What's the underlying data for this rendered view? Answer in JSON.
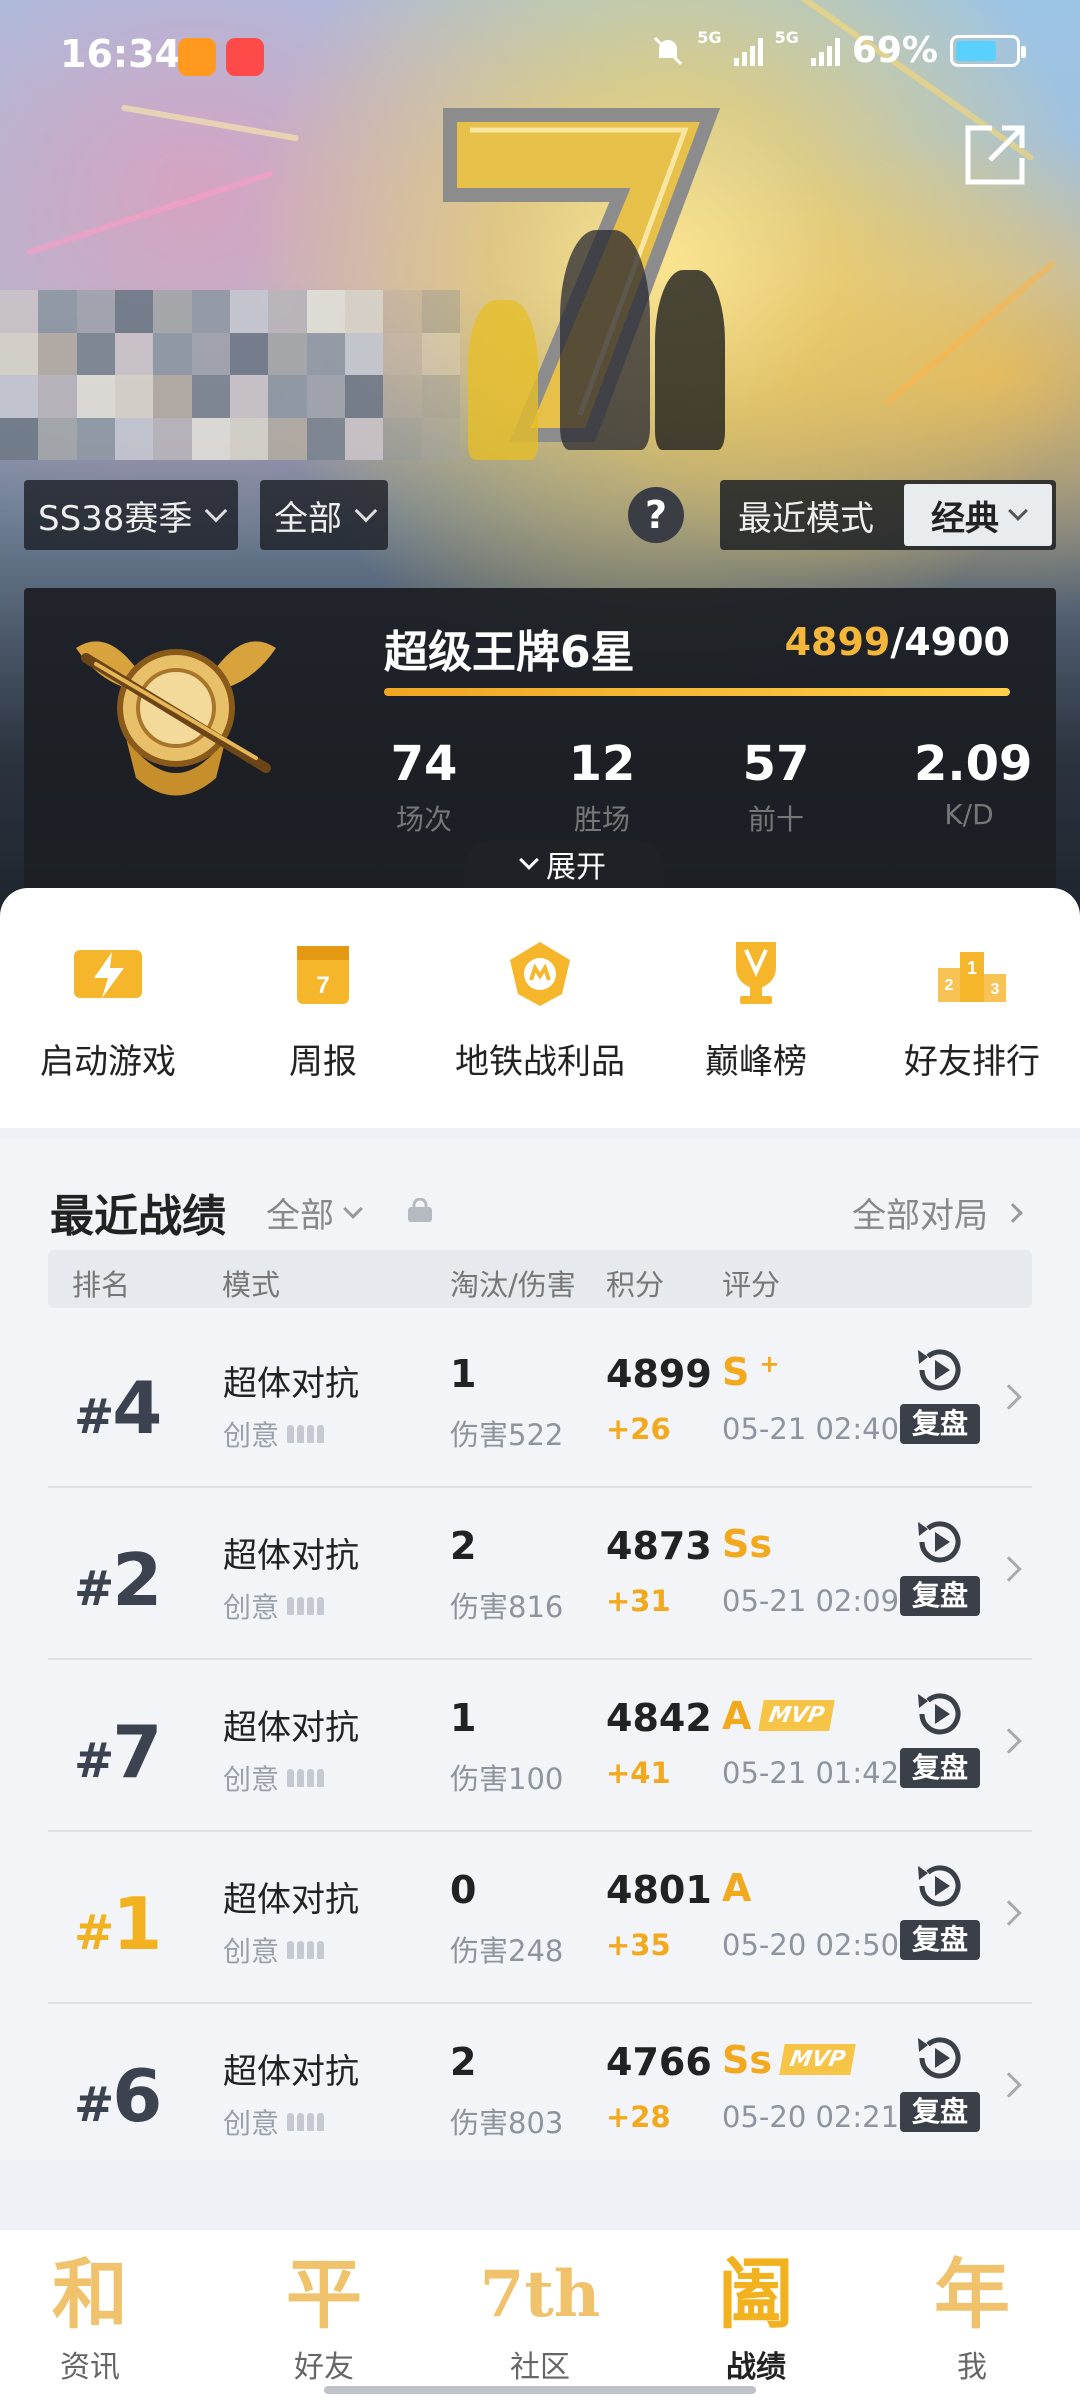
{
  "status_bar": {
    "time": "16:34",
    "network": "5G",
    "battery": "69%",
    "battery_level": 0.69
  },
  "filters": {
    "season": "SS38赛季",
    "scope": "全部",
    "recent_mode_label": "最近模式",
    "mode_selected": "经典"
  },
  "rank": {
    "name": "超级王牌6星",
    "score_current": "4899",
    "score_total": "/4900",
    "progress": 0.9998,
    "stats": [
      {
        "value": "74",
        "label": "场次"
      },
      {
        "value": "12",
        "label": "胜场"
      },
      {
        "value": "57",
        "label": "前十"
      },
      {
        "value": "2.09",
        "label": "K/D"
      }
    ],
    "expand_label": "展开"
  },
  "quick_actions": [
    {
      "label": "启动游戏",
      "icon": "lightning-icon"
    },
    {
      "label": "周报",
      "icon": "calendar-icon"
    },
    {
      "label": "地铁战利品",
      "icon": "metro-badge-icon"
    },
    {
      "label": "巅峰榜",
      "icon": "trophy-icon"
    },
    {
      "label": "好友排行",
      "icon": "podium-icon"
    }
  ],
  "records": {
    "title": "最近战绩",
    "filter": "全部",
    "all_matches": "全部对局",
    "columns": [
      "排名",
      "模式",
      "淘汰/伤害",
      "积分",
      "评分"
    ],
    "replay_label": "复盘",
    "rows": [
      {
        "rank_hash": "#",
        "rank": "4",
        "mode": "超体对抗",
        "sub": "创意",
        "kills": "1",
        "damage": "伤害522",
        "score": "4899",
        "delta": "+26",
        "grade": "S",
        "grade_sup": "+",
        "mvp": "",
        "date": "05-21 02:40"
      },
      {
        "rank_hash": "#",
        "rank": "2",
        "mode": "超体对抗",
        "sub": "创意",
        "kills": "2",
        "damage": "伤害816",
        "score": "4873",
        "delta": "+31",
        "grade": "Ss",
        "grade_sup": "",
        "mvp": "",
        "date": "05-21 02:09"
      },
      {
        "rank_hash": "#",
        "rank": "7",
        "mode": "超体对抗",
        "sub": "创意",
        "kills": "1",
        "damage": "伤害100",
        "score": "4842",
        "delta": "+41",
        "grade": "A",
        "grade_sup": "",
        "mvp": "MVP",
        "date": "05-21 01:42"
      },
      {
        "rank_hash": "#",
        "rank": "1",
        "mode": "超体对抗",
        "sub": "创意",
        "kills": "0",
        "damage": "伤害248",
        "score": "4801",
        "delta": "+35",
        "grade": "A",
        "grade_sup": "",
        "mvp": "",
        "date": "05-20 02:50"
      },
      {
        "rank_hash": "#",
        "rank": "6",
        "mode": "超体对抗",
        "sub": "创意",
        "kills": "2",
        "damage": "伤害803",
        "score": "4766",
        "delta": "+28",
        "grade": "Ss",
        "grade_sup": "",
        "mvp": "MVP",
        "date": "05-20 02:21"
      }
    ]
  },
  "bottom_nav": [
    {
      "glyph": "和",
      "label": "资讯"
    },
    {
      "glyph": "平",
      "label": "好友"
    },
    {
      "glyph": "7th",
      "label": "社区"
    },
    {
      "glyph": "阖",
      "label": "战绩",
      "active": true
    },
    {
      "glyph": "年",
      "label": "我"
    }
  ],
  "colors": {
    "accent": "#f2b21f",
    "card_dark": "#1c1e24"
  }
}
